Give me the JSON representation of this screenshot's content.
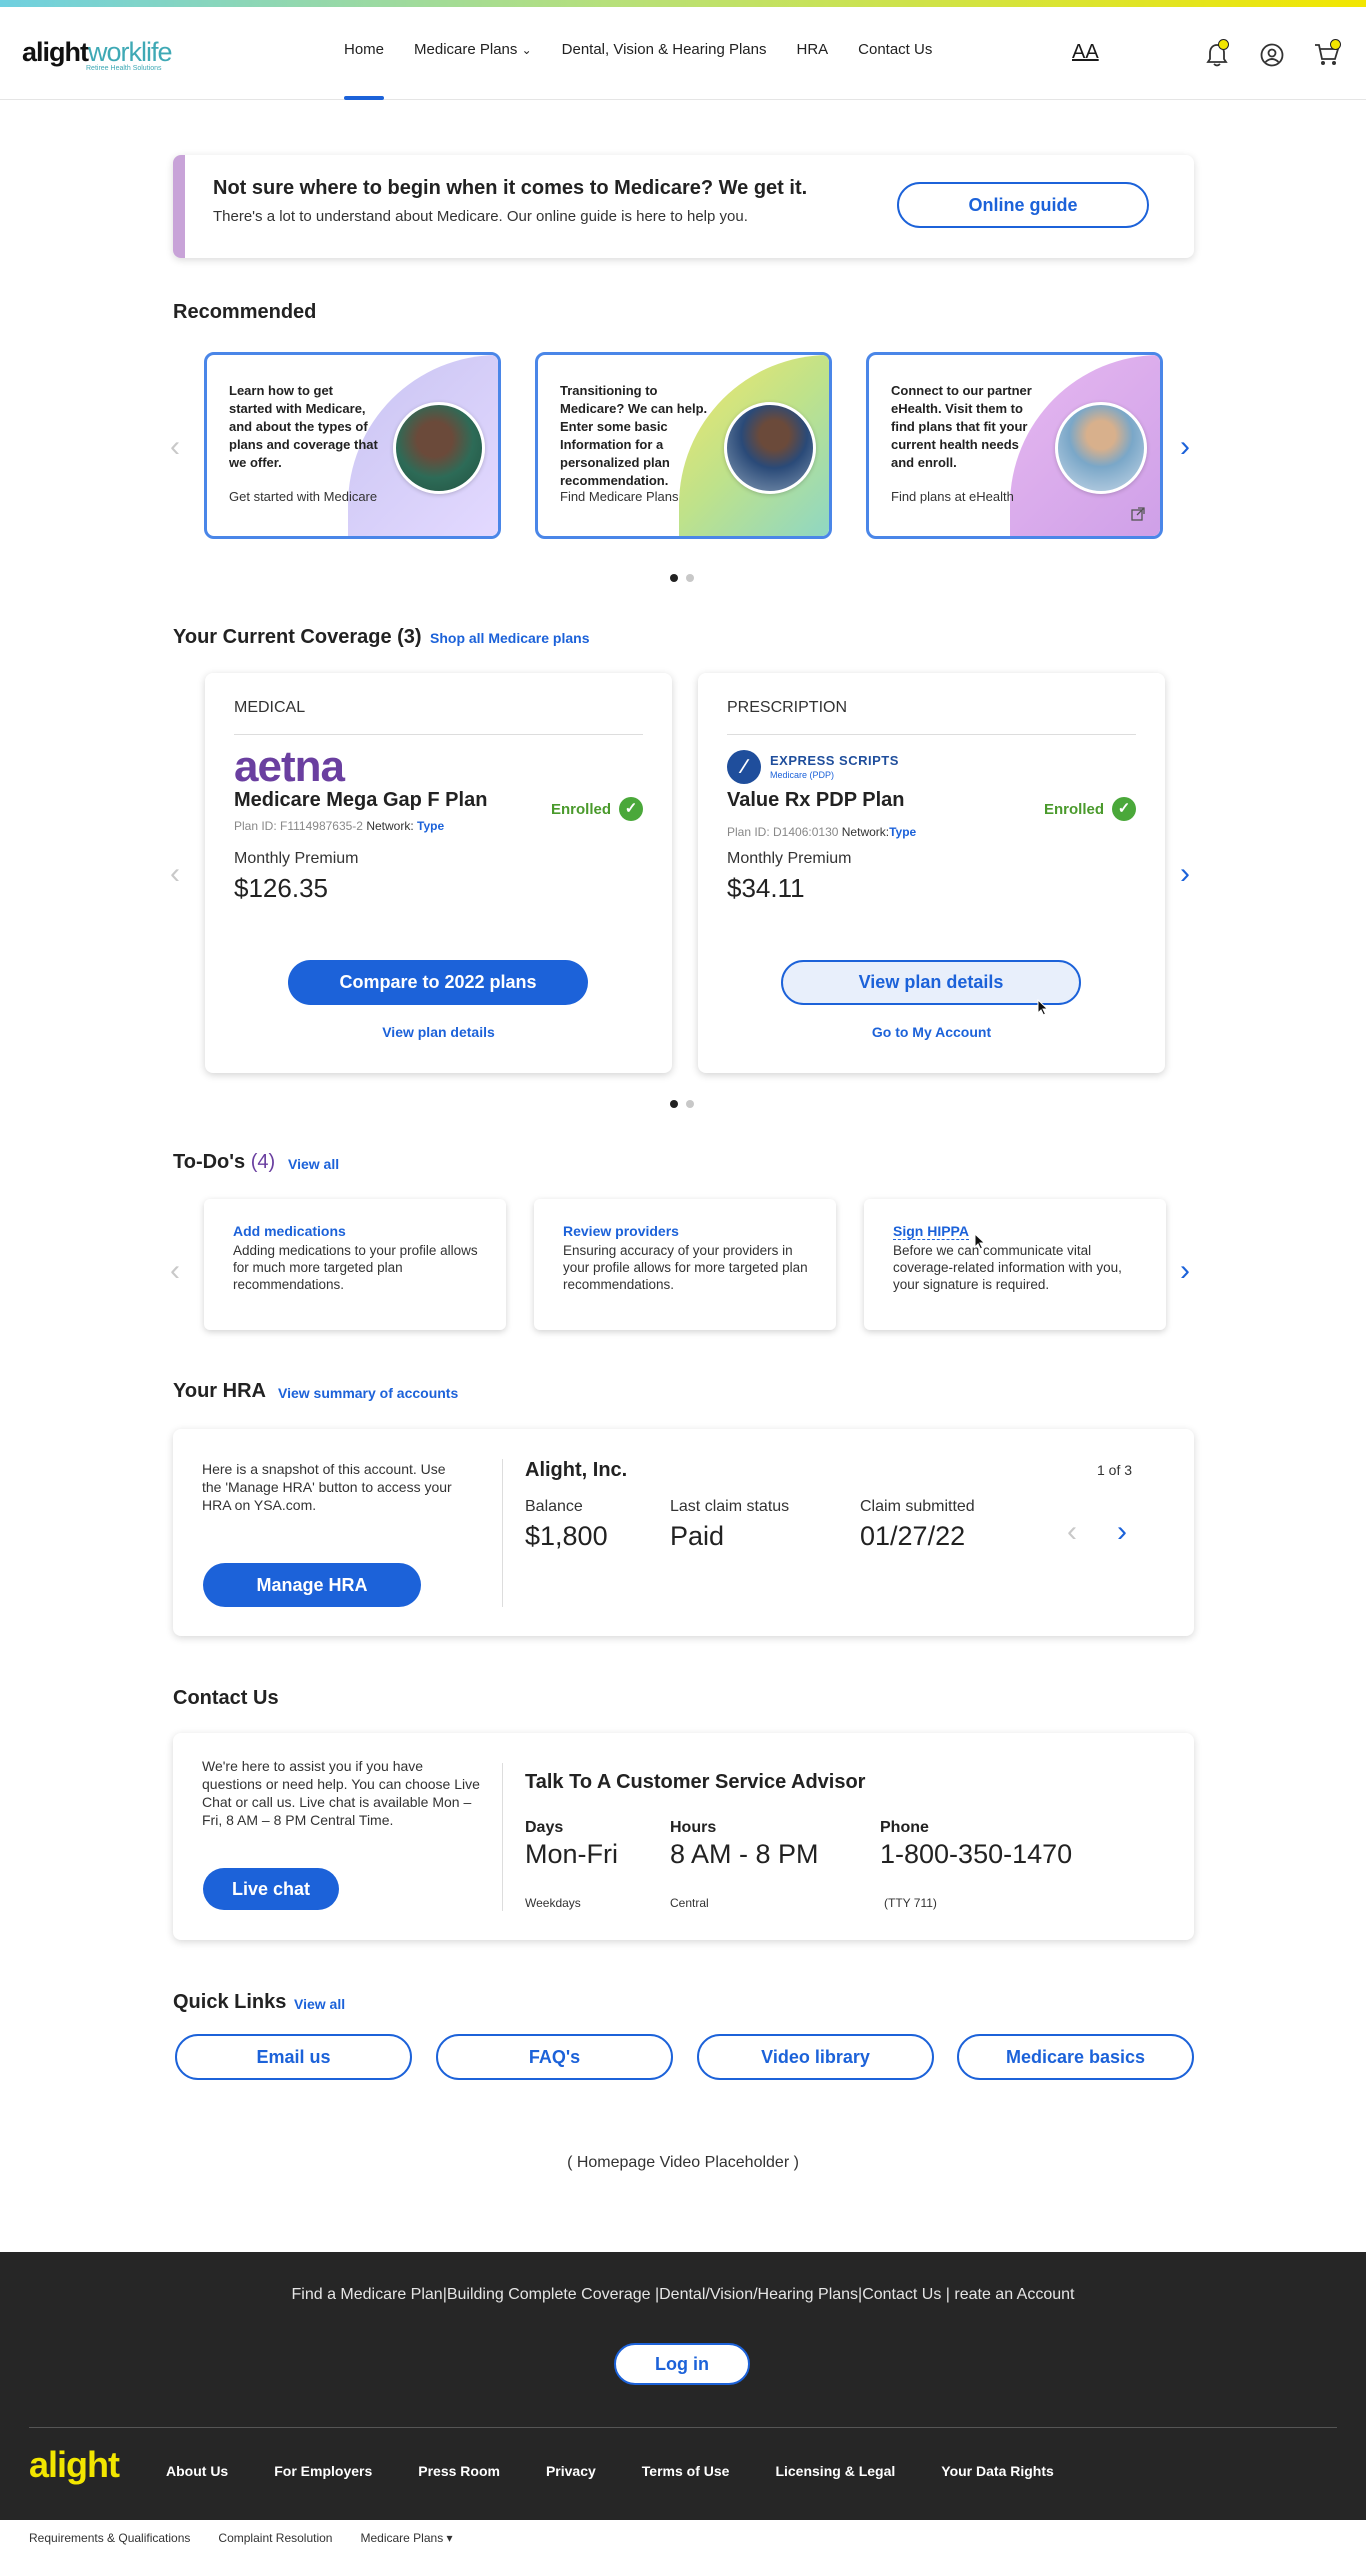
{
  "header": {
    "logo_main": "alight",
    "logo_accent": "worklife",
    "logo_tagline": "Retiree Health Solutions",
    "nav": [
      "Home",
      "Medicare Plans",
      "Dental, Vision & Hearing Plans",
      "HRA",
      "Contact Us"
    ],
    "text_size_label": "AA"
  },
  "guide": {
    "title": "Not sure where to begin when it comes to Medicare? We get it.",
    "text": "There's a lot to understand about Medicare. Our online guide is here to help you.",
    "button": "Online guide"
  },
  "recommended": {
    "title": "Recommended",
    "cards": [
      {
        "text": "Learn how to get started with Medicare, and about the types of plans and coverage that we offer.",
        "link": "Get started with Medicare"
      },
      {
        "text": "Transitioning to Medicare? We can help. Enter some basic Information for a personalized plan recommendation.",
        "link": "Find Medicare Plans"
      },
      {
        "text": "Connect to our partner eHealth. Visit them to find plans that fit your current health needs and enroll.",
        "link": "Find plans at eHealth"
      }
    ]
  },
  "coverage": {
    "title": "Your Current Coverage (3)",
    "shop_link": "Shop all Medicare plans",
    "cards": [
      {
        "type": "MEDICAL",
        "logo": "aetna",
        "plan": "Medicare Mega Gap F Plan",
        "plan_id": "Plan ID: F1114987635-2",
        "network_label": "Network:",
        "network_value": "Type",
        "status": "Enrolled",
        "premium_label": "Monthly Premium",
        "premium": "$126.35",
        "primary_button": "Compare to 2022 plans",
        "secondary_link": "View plan details"
      },
      {
        "type": "PRESCRIPTION",
        "logo": "EXPRESS SCRIPTS",
        "logo_sub": "Medicare (PDP)",
        "plan": "Value Rx PDP Plan",
        "plan_id": "Plan ID: D1406:0130",
        "network_label": "Network:",
        "network_value": "Type",
        "status": "Enrolled",
        "premium_label": "Monthly Premium",
        "premium": "$34.11",
        "primary_button": "View plan details",
        "secondary_link": "Go to My Account"
      }
    ]
  },
  "todos": {
    "title": "To-Do's",
    "count": "(4)",
    "view_all": "View all",
    "items": [
      {
        "title": "Add medications",
        "text": "Adding medications to your profile allows for much more targeted plan recommendations."
      },
      {
        "title": "Review providers",
        "text": "Ensuring accuracy of your providers in your profile allows for more targeted plan recommendations."
      },
      {
        "title": "Sign HIPPA",
        "text": "Before we can communicate vital coverage-related information with you, your signature is required."
      }
    ]
  },
  "hra": {
    "title": "Your HRA",
    "summary_link": "View summary of accounts",
    "intro": "Here is a snapshot of this account. Use the 'Manage HRA' button to access your HRA on YSA.com.",
    "button": "Manage HRA",
    "company": "Alight, Inc.",
    "pager": "1 of 3",
    "balance_label": "Balance",
    "balance": "$1,800",
    "status_label": "Last claim status",
    "status": "Paid",
    "submitted_label": "Claim submitted",
    "submitted": "01/27/22"
  },
  "contact": {
    "title": "Contact Us",
    "intro": "We're here to assist you if you have questions or need help. You can choose Live Chat or call us. Live chat is available Mon – Fri, 8 AM – 8 PM Central Time.",
    "button": "Live chat",
    "advisor_title": "Talk To A Customer Service Advisor",
    "days_label": "Days",
    "days": "Mon-Fri",
    "days_note": "Weekdays",
    "hours_label": "Hours",
    "hours": "8 AM - 8 PM",
    "hours_note": "Central",
    "phone_label": "Phone",
    "phone": "1-800-350-1470",
    "phone_note": "(TTY 711)"
  },
  "quick_links": {
    "title": "Quick Links",
    "view_all": "View all",
    "items": [
      "Email us",
      "FAQ's",
      "Video library",
      "Medicare basics"
    ]
  },
  "video_placeholder": "( Homepage Video Placeholder )",
  "footer": {
    "links": "Find a Medicare Plan|Building Complete Coverage |Dental/Vision/Hearing Plans|Contact Us | reate an Account",
    "login": "Log in",
    "logo": "alight",
    "nav": [
      "About Us",
      "For Employers",
      "Press Room",
      "Privacy",
      "Terms of Use",
      "Licensing & Legal",
      "Your Data Rights"
    ],
    "bottom": [
      "Requirements & Qualifications",
      "Complaint Resolution",
      "Medicare Plans"
    ]
  },
  "colors": {
    "accent": "#1c62d9",
    "success": "#4aa83a",
    "brand_yellow": "#f2e600",
    "brand_teal": "#3fa9b5"
  },
  "carousel_page": {
    "recommended": 1,
    "coverage": 1,
    "pages": 2
  }
}
